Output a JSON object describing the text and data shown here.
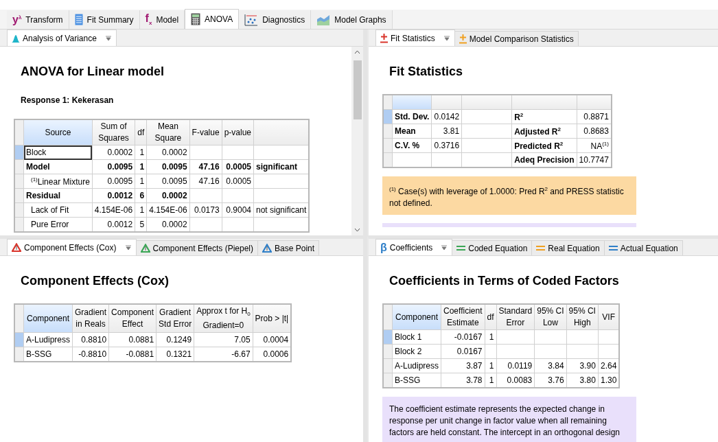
{
  "main_tabs": [
    {
      "label": "Transform",
      "selected": false,
      "kind": "glyph",
      "glyph": "y$^{λ}$"
    },
    {
      "label": "Fit Summary",
      "selected": false,
      "kind": "document"
    },
    {
      "label": "Model",
      "selected": false,
      "kind": "glyph",
      "glyph": "f$_{x}$"
    },
    {
      "label": "ANOVA",
      "selected": true,
      "kind": "calculator"
    },
    {
      "label": "Diagnostics",
      "selected": false,
      "kind": "scatter"
    },
    {
      "label": "Model Graphs",
      "selected": false,
      "kind": "area"
    }
  ],
  "panes": [
    {
      "tabs": [
        {
          "label": "Analysis of Variance",
          "selected": true,
          "kind": "bell",
          "color": "#1fb5c9",
          "dropdown": true
        }
      ],
      "scrollbar": true,
      "title": "ANOVA for Linear model",
      "subtitle": "Response 1: Kekerasan",
      "table": {
        "columns": [
          {
            "label": "Source",
            "kind": "text"
          },
          {
            "label": "Sum of\nSquares",
            "kind": "number"
          },
          {
            "label": "df",
            "kind": "number"
          },
          {
            "label": "Mean\nSquare",
            "kind": "number"
          },
          {
            "label": "F-value",
            "kind": "number"
          },
          {
            "label": "p-value",
            "kind": "number"
          },
          {
            "kind": "text"
          }
        ],
        "rows": [
          {
            "selected": true,
            "cells": [
              "Block",
              "0.0002",
              "1",
              "0.0002",
              null,
              null,
              null
            ]
          },
          {
            "selected": false,
            "bold": true,
            "cells": [
              "Model",
              "0.0095",
              "1",
              "0.0095",
              "47.16",
              "0.0005",
              "significant"
            ],
            "children": [
              {
                "selected": false,
                "cells": [
                  "$^{(1)}$Linear Mixture",
                  "0.0095",
                  "1",
                  "0.0095",
                  "47.16",
                  "0.0005",
                  null
                ]
              }
            ]
          },
          {
            "selected": false,
            "bold": true,
            "cells": [
              "Residual",
              "0.0012",
              "6",
              "0.0002",
              null,
              null,
              null
            ],
            "children": [
              {
                "selected": false,
                "cells": [
                  "Lack of Fit",
                  "4.154E-06",
                  "1",
                  "4.154E-06",
                  "0.0173",
                  "0.9004",
                  "not significant"
                ]
              },
              {
                "selected": false,
                "cells": [
                  "Pure Error",
                  "0.0012",
                  "5",
                  "0.0002",
                  null,
                  null,
                  null
                ]
              }
            ]
          }
        ]
      }
    },
    {
      "tabs": [
        {
          "label": "Fit Statistics",
          "selected": true,
          "kind": "plusminus",
          "color": "#d9342b",
          "dropdown": true
        },
        {
          "label": "Model Comparison Statistics",
          "selected": false,
          "kind": "plusminus",
          "color": "#f0a020"
        }
      ],
      "title": "Fit Statistics",
      "table": {
        "columns": [
          {
            "kind": "text",
            "bold": true
          },
          {
            "kind": "number"
          },
          {
            "kind": "blank"
          },
          {
            "kind": "text",
            "bold": true
          },
          {
            "kind": "number"
          }
        ],
        "rows": [
          {
            "selected": true,
            "cells": [
              "Std. Dev.",
              "0.0142",
              null,
              "R$^{2}$",
              "0.8871"
            ]
          },
          {
            "selected": false,
            "cells": [
              "Mean",
              "3.81",
              null,
              "Adjusted R$^{2}$",
              "0.8683"
            ]
          },
          {
            "selected": false,
            "cells": [
              "C.V. %",
              "0.3716",
              null,
              "Predicted R$^{2}$",
              "NA$^{(1)}$"
            ]
          },
          {
            "selected": false,
            "cells": [
              null,
              null,
              null,
              "Adeq Precision",
              "10.7747"
            ]
          }
        ]
      },
      "notes": [
        {
          "kind": "footnote",
          "text": "$^{(1)}$ Case(s) with leverage of 1.0000: Pred R$^{2}$ and PRESS statistic not defined."
        },
        {
          "kind": "info"
        }
      ]
    },
    {
      "tabs": [
        {
          "label": "Component Effects (Cox)",
          "selected": true,
          "kind": "triangle",
          "color": "#d9342b",
          "dropdown": true
        },
        {
          "label": "Component Effects (Piepel)",
          "selected": false,
          "kind": "triangle",
          "color": "#3aa655"
        },
        {
          "label": "Base Point",
          "selected": false,
          "kind": "triangle",
          "color": "#2f7fc8"
        }
      ],
      "title": "Component Effects (Cox)",
      "table": {
        "columns": [
          {
            "label": "Component",
            "kind": "text"
          },
          {
            "label": "Gradient\nin Reals",
            "kind": "number"
          },
          {
            "label": "Component\nEffect",
            "kind": "number"
          },
          {
            "label": "Gradient\nStd Error",
            "kind": "number"
          },
          {
            "label": "Approx t for H$_{0}$\nGradient=0",
            "kind": "number"
          },
          {
            "label": "Prob > |t|",
            "kind": "number"
          }
        ],
        "rows": [
          {
            "selected": true,
            "cells": [
              "A-Ludipress",
              "0.8810",
              "0.0881",
              "0.1249",
              "7.05",
              "0.0004"
            ]
          },
          {
            "selected": false,
            "cells": [
              "B-SSG",
              "-0.8810",
              "-0.0881",
              "0.1321",
              "-6.67",
              "0.0006"
            ]
          }
        ]
      }
    },
    {
      "tabs": [
        {
          "label": "Coefficients",
          "selected": true,
          "kind": "glyph",
          "glyph": "β",
          "color": "#2f7fc8",
          "dropdown": true
        },
        {
          "label": "Coded Equation",
          "selected": false,
          "kind": "equals",
          "color": "#3aa655"
        },
        {
          "label": "Real Equation",
          "selected": false,
          "kind": "equals",
          "color": "#f0a020"
        },
        {
          "label": "Actual Equation",
          "selected": false,
          "kind": "equals",
          "color": "#2f7fc8"
        }
      ],
      "title": "Coefficients in Terms of Coded Factors",
      "table": {
        "columns": [
          {
            "label": "Component",
            "kind": "text"
          },
          {
            "label": "Coefficient\nEstimate",
            "kind": "number"
          },
          {
            "label": "df",
            "kind": "number"
          },
          {
            "label": "Standard\nError",
            "kind": "number"
          },
          {
            "label": "95% CI\nLow",
            "kind": "number"
          },
          {
            "label": "95% CI\nHigh",
            "kind": "number"
          },
          {
            "label": "VIF",
            "kind": "number"
          }
        ],
        "rows": [
          {
            "selected": true,
            "cells": [
              "Block 1",
              "-0.0167",
              "1",
              null,
              null,
              null,
              null
            ]
          },
          {
            "selected": false,
            "cells": [
              "Block 2",
              "0.0167",
              null,
              null,
              null,
              null,
              null
            ]
          },
          {
            "selected": false,
            "cells": [
              "A-Ludipress",
              "3.87",
              "1",
              "0.0119",
              "3.84",
              "3.90",
              "2.64"
            ]
          },
          {
            "selected": false,
            "cells": [
              "B-SSG",
              "3.78",
              "1",
              "0.0083",
              "3.76",
              "3.80",
              "1.30"
            ]
          }
        ]
      },
      "notes": [
        {
          "kind": "info",
          "text": "The coefficient estimate represents the expected change in response per unit change in factor value when all remaining factors are held constant. The intercept in an orthogonal design"
        }
      ]
    }
  ]
}
